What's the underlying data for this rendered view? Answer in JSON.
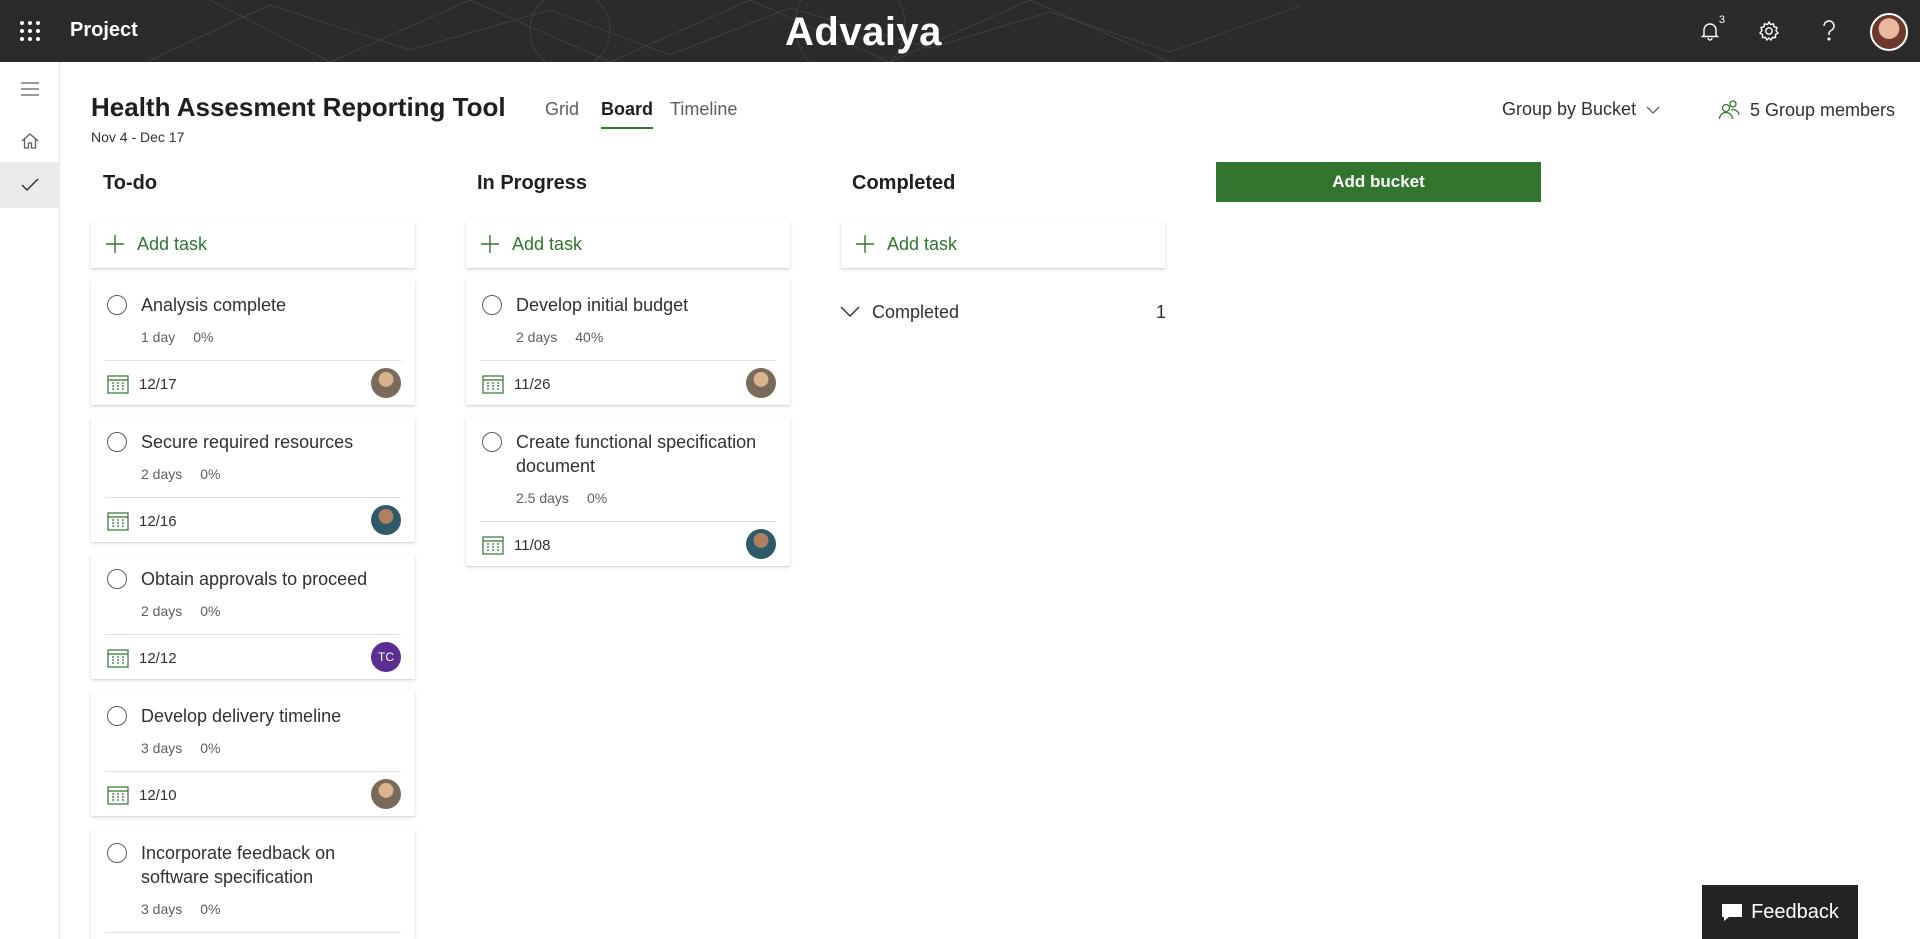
{
  "topbar": {
    "app_name": "Project",
    "brand": "Advaiya",
    "notification_count": "3"
  },
  "header": {
    "title": "Health Assesment Reporting Tool",
    "dates": "Nov 4 - Dec 17",
    "tabs": [
      {
        "label": "Grid"
      },
      {
        "label": "Board"
      },
      {
        "label": "Timeline"
      }
    ],
    "active_tab": "Board",
    "group_by": "Group by Bucket",
    "members": "5 Group members"
  },
  "buckets": [
    {
      "name": "To-do",
      "add_task_label": "Add task",
      "tasks": [
        {
          "title": "Analysis complete",
          "duration": "1 day",
          "progress": "0%",
          "due": "12/17",
          "assignee": "photo"
        },
        {
          "title": "Secure required resources",
          "duration": "2 days",
          "progress": "0%",
          "due": "12/16",
          "assignee": "photo"
        },
        {
          "title": "Obtain approvals to proceed",
          "duration": "2 days",
          "progress": "0%",
          "due": "12/12",
          "assignee": "TC"
        },
        {
          "title": "Develop delivery timeline",
          "duration": "3 days",
          "progress": "0%",
          "due": "12/10",
          "assignee": "photo"
        },
        {
          "title": "Incorporate feedback on software specification",
          "duration": "3 days",
          "progress": "0%"
        }
      ]
    },
    {
      "name": "In Progress",
      "add_task_label": "Add task",
      "tasks": [
        {
          "title": "Develop initial budget",
          "duration": "2 days",
          "progress": "40%",
          "due": "11/26",
          "assignee": "photo"
        },
        {
          "title": "Create functional specification document",
          "duration": "2.5 days",
          "progress": "0%",
          "due": "11/08",
          "assignee": "photo"
        }
      ]
    },
    {
      "name": "Completed",
      "add_task_label": "Add task",
      "completed_label": "Completed",
      "completed_count": "1"
    }
  ],
  "add_bucket_label": "Add bucket",
  "feedback_label": "Feedback",
  "colors": {
    "accent": "#31752f",
    "topbar": "#2b2b2b",
    "tc_avatar": "#5c2e91"
  }
}
